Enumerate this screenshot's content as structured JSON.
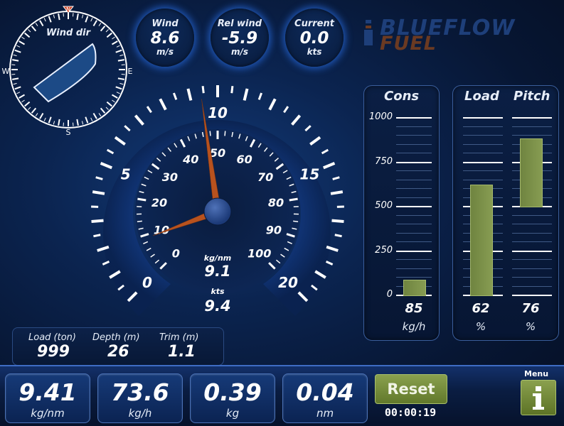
{
  "compass": {
    "title": "Wind dir",
    "n": "N",
    "e": "E",
    "s": "S",
    "w": "W"
  },
  "top_gauges": [
    {
      "label": "Wind",
      "value": "8.6",
      "unit": "m/s"
    },
    {
      "label": "Rel wind",
      "value": "-5.9",
      "unit": "m/s"
    },
    {
      "label": "Current",
      "value": "0.0",
      "unit": "kts"
    }
  ],
  "logo": {
    "line1": "BLUEFLOW",
    "line2": "FUEL"
  },
  "speedometer": {
    "outer_labels": [
      "0",
      "5",
      "10",
      "15",
      "20"
    ],
    "inner_labels": [
      "0",
      "10",
      "20",
      "30",
      "40",
      "50",
      "60",
      "70",
      "80",
      "90",
      "100"
    ],
    "fuel_label": "kg/nm",
    "fuel_value": "9.1",
    "speed_label": "kts",
    "speed_value": "9.4",
    "outer_needle_value": 9.4,
    "inner_needle_value": 9.1
  },
  "cons_panel": {
    "title": "Cons",
    "scale": [
      "1000",
      "750",
      "500",
      "250",
      "0"
    ],
    "value": "85",
    "unit": "kg/h",
    "fraction": 0.085
  },
  "load_pitch_panel": {
    "load_title": "Load",
    "pitch_title": "Pitch",
    "load_value": "62",
    "pitch_value": "76",
    "load_unit": "%",
    "pitch_unit": "%",
    "load_fraction": 0.62,
    "pitch_top_fraction": 0.88,
    "pitch_bottom_fraction": 0.5
  },
  "info": [
    {
      "label": "Load (ton)",
      "value": "999"
    },
    {
      "label": "Depth (m)",
      "value": "26"
    },
    {
      "label": "Trim (m)",
      "value": "1.1"
    }
  ],
  "bottom": [
    {
      "value": "9.41",
      "unit": "kg/nm"
    },
    {
      "value": "73.6",
      "unit": "kg/h"
    },
    {
      "value": "0.39",
      "unit": "kg"
    },
    {
      "value": "0.04",
      "unit": "nm"
    }
  ],
  "reset_label": "Reset",
  "timer": "00:00:19",
  "menu_label": "Menu",
  "colors": {
    "accent": "#3e6cc4",
    "needle": "#b8521e",
    "bar": "#7d9248",
    "button": "#7a9140"
  }
}
